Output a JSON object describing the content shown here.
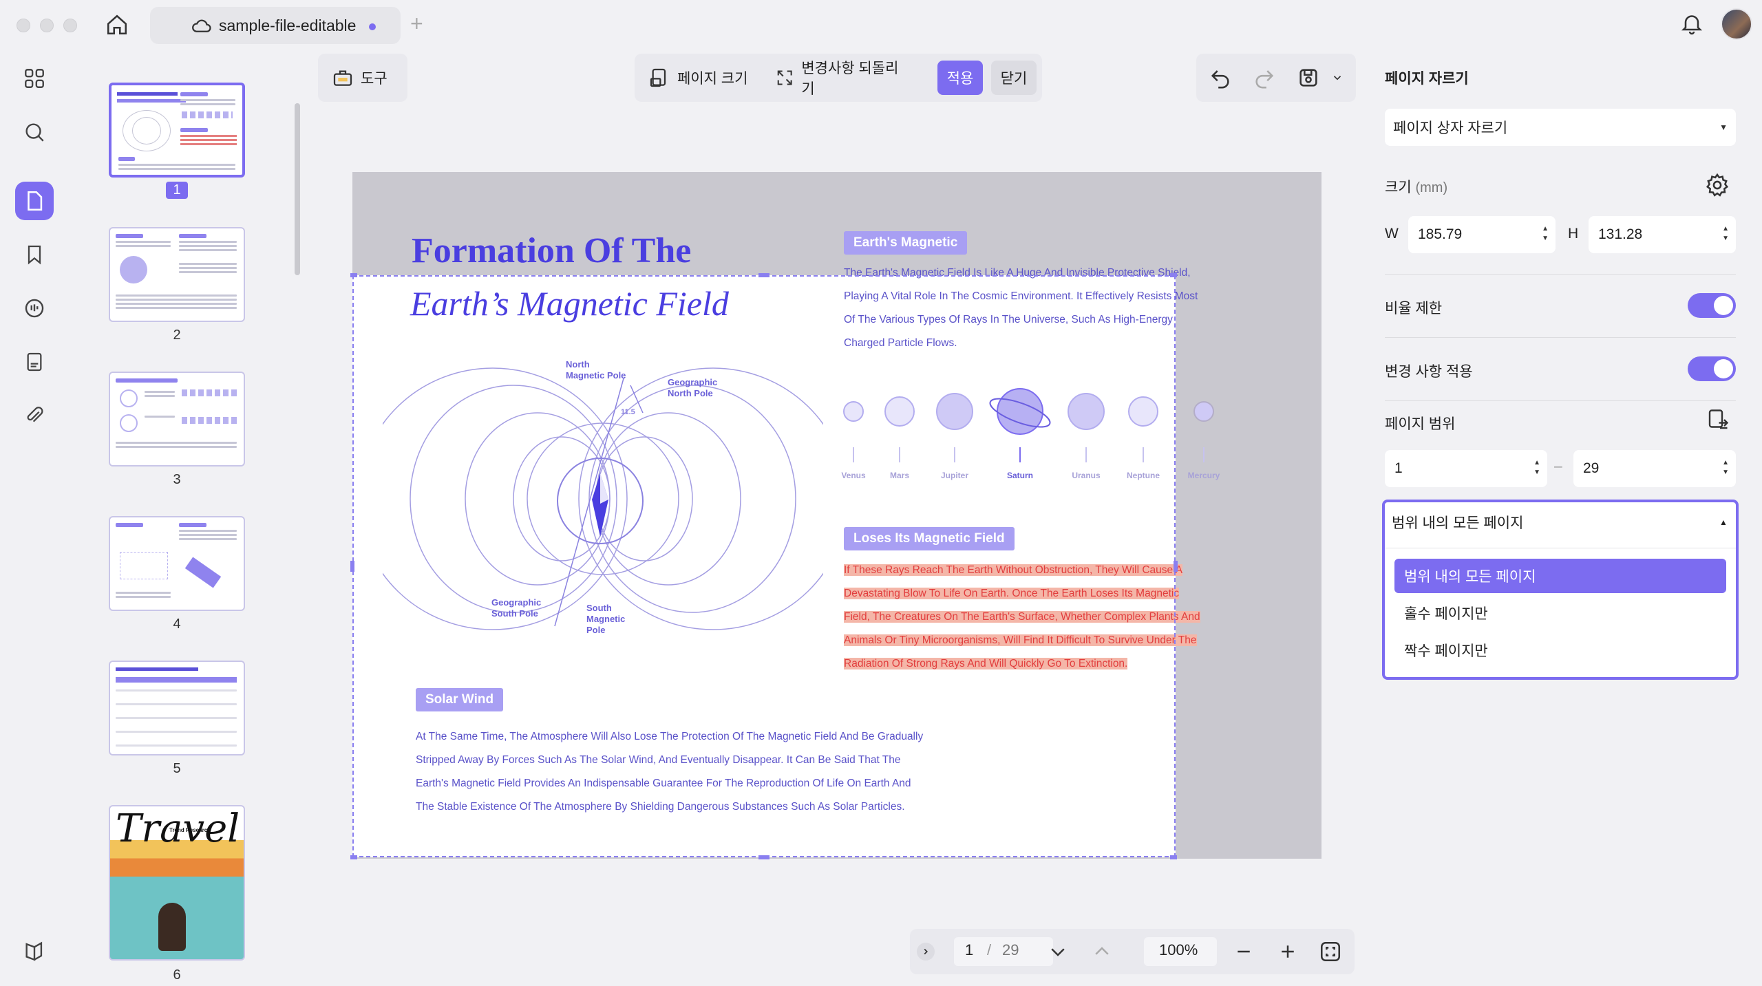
{
  "titlebar": {
    "tab_title": "sample-file-editable",
    "new_tab": "+"
  },
  "rail": {
    "items": [
      {
        "name": "grid-icon"
      },
      {
        "name": "search-icon"
      },
      {
        "name": "page-icon",
        "active": true
      },
      {
        "name": "bookmark-icon"
      },
      {
        "name": "comment-icon"
      },
      {
        "name": "form-icon"
      },
      {
        "name": "attachment-icon"
      },
      {
        "name": "layers-icon"
      }
    ]
  },
  "thumbnails": {
    "pages": [
      "1",
      "2",
      "3",
      "4",
      "5",
      "6"
    ],
    "travel_title": "Travel",
    "travel_sub": "Trend Research"
  },
  "toolbar": {
    "tools_label": "도구",
    "page_size_label": "페이지 크기",
    "revert_label": "변경사항 되돌리기",
    "apply_label": "적용",
    "close_label": "닫기"
  },
  "document": {
    "title_line1": "Formation Of The",
    "title_line2": "Earth’s Magnetic Field",
    "pill_magnetic": "Earth's Magnetic",
    "para_magnetic": [
      "The Earth's Magnetic Field Is Like A Huge And Invisible Protective Shield,",
      "Playing A Vital Role In The Cosmic Environment. It Effectively Resists Most",
      "Of The Various Types Of Rays In The Universe, Such As High-Energy",
      "Charged Particle Flows."
    ],
    "planets": [
      "Venus",
      "Mars",
      "Jupiter",
      "Saturn",
      "Uranus",
      "Neptune",
      "Mercury"
    ],
    "diagram_labels": {
      "north_magnetic": "North\nMagnetic Pole",
      "geo_north": "Geographic\nNorth Pole",
      "angle": "11.5",
      "geo_south": "Geographic\nSouth Pole",
      "south_magnetic": "South\nMagnetic\nPole"
    },
    "pill_loses": "Loses Its Magnetic Field",
    "para_loses": [
      "If These Rays Reach The Earth Without Obstruction, They Will Cause A",
      "Devastating Blow To Life On Earth. Once The Earth Loses Its Magnetic",
      "Field, The Creatures On The Earth's Surface, Whether Complex Plants And",
      "Animals Or Tiny Microorganisms, Will Find It Difficult To Survive Under The",
      "Radiation Of Strong Rays And Will Quickly Go To Extinction."
    ],
    "pill_solar": "Solar Wind",
    "para_solar": [
      "At The Same Time, The Atmosphere Will Also Lose The Protection Of The Magnetic Field And Be Gradually",
      "Stripped Away By Forces Such As The Solar Wind, And Eventually Disappear. It Can Be Said That The",
      "Earth's Magnetic Field Provides An Indispensable Guarantee For The Reproduction Of Life On Earth And",
      "The Stable Existence Of The Atmosphere By Shielding Dangerous Substances Such As Solar Particles."
    ]
  },
  "panel": {
    "title": "페이지 자르기",
    "crop_mode": "페이지 상자 자르기",
    "size_label": "크기",
    "size_unit": "(mm)",
    "w_label": "W",
    "w_value": "185.79",
    "h_label": "H",
    "h_value": "131.28",
    "ratio_label": "비율 제한",
    "apply_changes_label": "변경 사항 적용",
    "range_label": "페이지 범위",
    "range_from": "1",
    "range_dash": "–",
    "range_to": "29",
    "range_select": "범위 내의 모든 페이지",
    "range_options": [
      "범위 내의 모든 페이지",
      "홀수 페이지만",
      "짝수 페이지만"
    ]
  },
  "bottom_nav": {
    "current_page": "1",
    "separator": "/",
    "total_pages": "29",
    "zoom": "100%"
  },
  "colors": {
    "accent": "#7c6cf0",
    "doc_blue": "#4a3ee0",
    "highlight_red": "#e23d3d"
  }
}
